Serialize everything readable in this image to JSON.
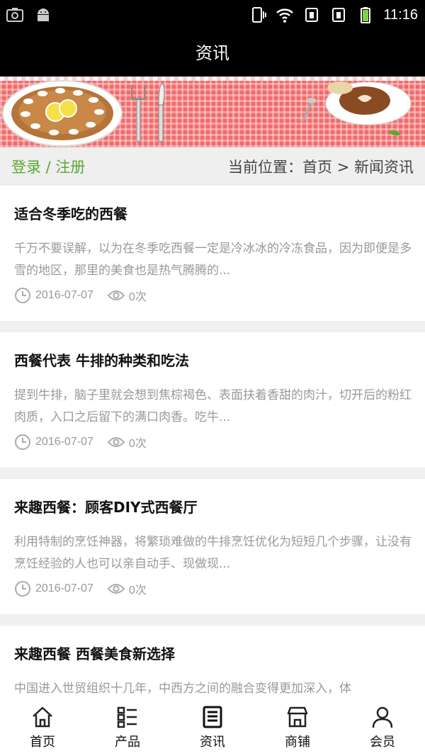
{
  "status_bar": {
    "time": "11:16"
  },
  "header": {
    "title": "资讯"
  },
  "location_bar": {
    "login_label": "登录 / 注册",
    "current_location": "当前位置：首页 > 新闻资讯"
  },
  "news": [
    {
      "title": "适合冬季吃的西餐",
      "summary": "千万不要误解，以为在冬季吃西餐一定是冷冰冰的冷冻食品，因为即便是多雪的地区，那里的美食也是热气腾腾的...",
      "date": "2016-07-07",
      "views": "0次"
    },
    {
      "title": "西餐代表 牛排的种类和吃法",
      "summary": "提到牛排，脑子里就会想到焦棕褐色、表面扶着香甜的肉汁，切开后的粉红肉质，入口之后留下的满口肉香。吃牛...",
      "date": "2016-07-07",
      "views": "0次"
    },
    {
      "title": "来趣西餐：顾客DIY式西餐厅",
      "summary": "利用特制的烹饪神器，将繁琐难做的牛排烹饪优化为短短几个步骤，让没有烹饪经验的人也可以亲自动手、现做现...",
      "date": "2016-07-07",
      "views": "0次"
    },
    {
      "title": "来趣西餐 西餐美食新选择",
      "summary": "中国进入世贸组织十几年，中西方之间的融合变得更加深入，体",
      "date": "",
      "views": ""
    }
  ],
  "bottom_nav": [
    {
      "label": "首页",
      "icon": "home-icon"
    },
    {
      "label": "产品",
      "icon": "grid-list-icon"
    },
    {
      "label": "资讯",
      "icon": "news-icon"
    },
    {
      "label": "商铺",
      "icon": "shop-icon"
    },
    {
      "label": "会员",
      "icon": "user-icon"
    }
  ],
  "colors": {
    "header_bg": "#000000",
    "login_green": "#5aa832",
    "banner_red": "#f06a6a"
  }
}
